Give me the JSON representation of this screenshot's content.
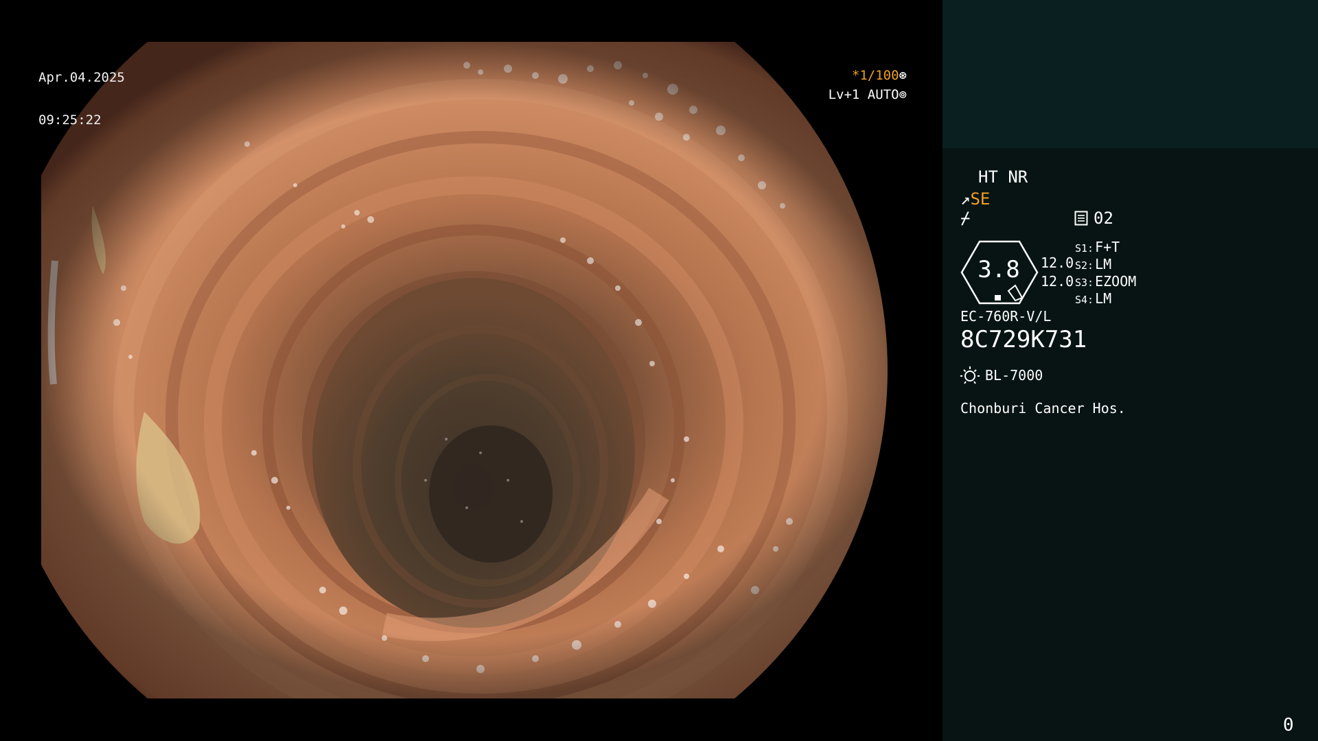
{
  "overlay": {
    "date": "Apr.04.2025",
    "time": "09:25:22",
    "shutter_speed": "*1/100",
    "shutter_icon": "aperture-icon",
    "light_level": "Lv+1 AUTO",
    "light_icon": "iris-icon"
  },
  "panel": {
    "ht_nr": "HT NR",
    "enhance_mode": "SE",
    "enhance_icon": "scope-arrow-icon",
    "slash_icon_glyph": "⌿",
    "memo_icon": "memo-card-icon",
    "memo_value": "02",
    "gauge_value": "3.8",
    "num_a": "12.0",
    "num_b": "12.0",
    "switches": [
      {
        "key": "S1:",
        "value": "F+T"
      },
      {
        "key": "S2:",
        "value": "LM"
      },
      {
        "key": "S3:",
        "value": "EZOOM"
      },
      {
        "key": "S4:",
        "value": "LM"
      }
    ],
    "scope_model": "EC-760R-V/L",
    "scope_serial": "8C729K731",
    "light_source_icon": "sun-lamp-icon",
    "light_source": "BL-7000",
    "hospital": "Chonburi Cancer Hos.",
    "page_counter": "0"
  },
  "colors": {
    "background": "#000000",
    "panel_bg": "#081414",
    "panel_top_bg": "#0a1f20",
    "accent_amber": "#f0a020",
    "mucosa": "#c07b58"
  }
}
